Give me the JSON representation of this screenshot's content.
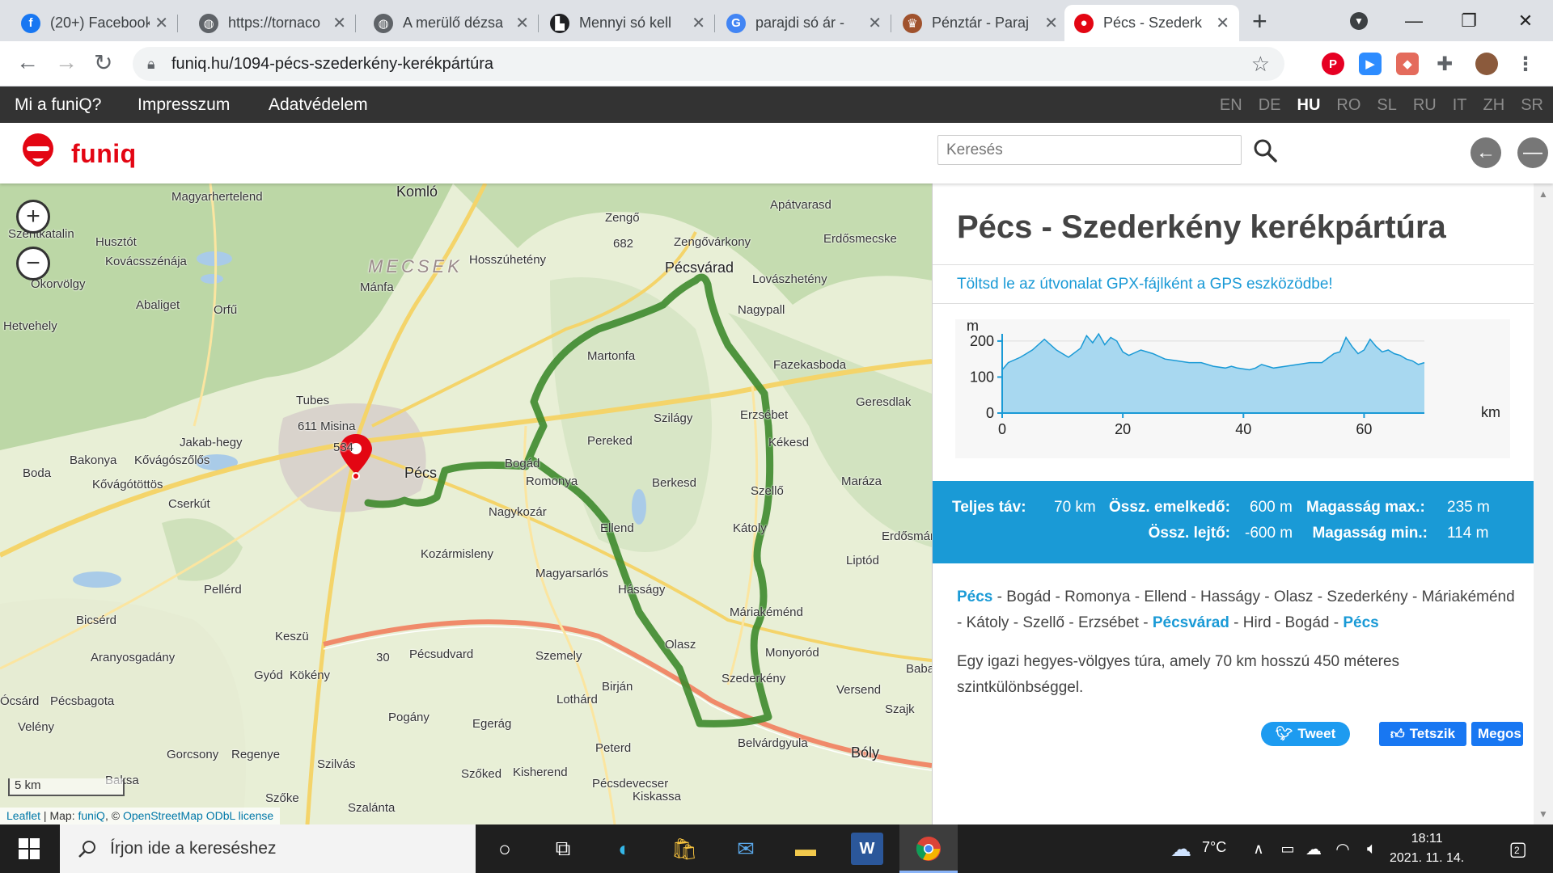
{
  "browser": {
    "tabs": [
      {
        "title": "(20+) Facebook",
        "favicon_color": "#1877f2",
        "favicon_glyph": "f"
      },
      {
        "title": "https://tornaco",
        "favicon_color": "#5f6368",
        "favicon_glyph": "◍"
      },
      {
        "title": "A merülő dézsa",
        "favicon_color": "#5f6368",
        "favicon_glyph": "◍"
      },
      {
        "title": "Mennyi só kell",
        "favicon_color": "#202124",
        "favicon_glyph": "▙"
      },
      {
        "title": "parajdi só ár -",
        "favicon_color": "#4285f4",
        "favicon_glyph": "G"
      },
      {
        "title": "Pénztár - Paraj",
        "favicon_color": "#a0522d",
        "favicon_glyph": "♛"
      },
      {
        "title": "Pécs - Szederk",
        "favicon_color": "#e30613",
        "favicon_glyph": "●",
        "active": true
      }
    ],
    "url": "funiq.hu/1094-pécs-szederkény-kerékpártúra"
  },
  "site": {
    "menu": [
      "Mi a funiQ?",
      "Impresszum",
      "Adatvédelem"
    ],
    "languages": [
      "EN",
      "DE",
      "HU",
      "RO",
      "SL",
      "RU",
      "IT",
      "ZH",
      "SR"
    ],
    "current_language": "HU",
    "brand": "funiq",
    "search_placeholder": "Keresés",
    "brand_color": "#e30613",
    "accent_color": "#1a9ad6"
  },
  "map": {
    "labels": [
      "Komló",
      "Magyarhertelend",
      "Szentkatalin",
      "Husztót",
      "Kovácsszénája",
      "Okorvölgy",
      "Abaliget",
      "Orfű",
      "Hetvehely",
      "Mánfa",
      "MECSEK",
      "Hosszúhetény",
      "Zengő",
      "682",
      "Apátvarasd",
      "Zengővárkony",
      "Erdősmecske",
      "Pécsvárad",
      "Lovászhetény",
      "Nagypall",
      "Martonfa",
      "Fazekasboda",
      "Geresdlak",
      "Tubes",
      "611 Misina",
      "Jakab-hegy",
      "534",
      "Szilágy",
      "Erzsébet",
      "Kékesd",
      "Pereked",
      "Bakonya",
      "Kővágószőlős",
      "Kővágótöttös",
      "Boda",
      "Pécs",
      "Bogád",
      "Romonya",
      "Berkesd",
      "Maráza",
      "Szellő",
      "Cserkút",
      "Nagykozár",
      "Ellend",
      "Kátoly",
      "Erdősmár",
      "Kozármisleny",
      "Magyarsarlós",
      "Liptód",
      "Pellérd",
      "Hásságy",
      "Bicsérd",
      "Keszü",
      "Máriakéménd",
      "Olasz",
      "Aranyosgadány",
      "Pécsudvard",
      "Szemely",
      "Monyoród",
      "30",
      "Gyód",
      "Kökény",
      "Szederkény",
      "Versend",
      "Pécsbagota",
      "Birján",
      "Lothárd",
      "Szajk",
      "Pogány",
      "Egerág",
      "Velény",
      "Belvárdgyula",
      "Gorcsony",
      "Regenye",
      "Peterd",
      "Bóly",
      "Szilvás",
      "Szőked",
      "Kisherend",
      "Pécsdevecser",
      "Kiskassa",
      "Baksa",
      "Szőke",
      "Szalánta",
      "Ócsárd",
      "Babarc"
    ],
    "zoom_in": "+",
    "zoom_out": "−",
    "scale": "5 km",
    "attribution": {
      "leaflet": "Leaflet",
      "map": "Map:",
      "funiq": "funiQ",
      "copy": ", ©",
      "osm": "OpenStreetMap",
      "odbl": "ODbL license"
    }
  },
  "tour": {
    "title": "Pécs - Szederkény kerékpártúra",
    "gpx_link": "Töltsd le az útvonalat GPX-fájlként a GPS eszközödbe!",
    "stats": {
      "total_label": "Teljes táv:",
      "total_value": "70 km",
      "ascent_label": "Össz. emelkedő:",
      "ascent_value": "600 m",
      "descent_label": "Össz. lejtő:",
      "descent_value": "-600 m",
      "max_label": "Magasság max.:",
      "max_value": "235 m",
      "min_label": "Magasság min.:",
      "min_value": "114 m"
    },
    "route": [
      {
        "name": "Pécs",
        "highlight": true
      },
      {
        "name": "Bogád"
      },
      {
        "name": "Romonya"
      },
      {
        "name": "Ellend"
      },
      {
        "name": "Hasságy"
      },
      {
        "name": "Olasz"
      },
      {
        "name": "Szederkény"
      },
      {
        "name": "Máriakéménd"
      },
      {
        "name": "Kátoly"
      },
      {
        "name": "Szellő"
      },
      {
        "name": "Erzsébet"
      },
      {
        "name": "Pécsvárad",
        "highlight": true
      },
      {
        "name": "Hird"
      },
      {
        "name": "Bogád"
      },
      {
        "name": "Pécs",
        "highlight": true
      }
    ],
    "description": "Egy igazi hegyes-völgyes túra, amely 70 km hosszú 450 méteres szintkülönbséggel.",
    "share": {
      "tweet": "Tweet",
      "like": "Tetszik",
      "share": "Megos"
    }
  },
  "chart_data": {
    "type": "area",
    "title": "",
    "xlabel": "km",
    "ylabel": "m",
    "xlim": [
      0,
      70
    ],
    "ylim": [
      0,
      220
    ],
    "xticks": [
      0,
      20,
      40,
      60
    ],
    "yticks": [
      0,
      100,
      200
    ],
    "grid": true,
    "series": [
      {
        "x": [
          0,
          1,
          3,
          5,
          7,
          9,
          11,
          13,
          14,
          15,
          16,
          17,
          18,
          19,
          20,
          21,
          23,
          25,
          27,
          29,
          31,
          33,
          35,
          37,
          38,
          39,
          41,
          42,
          43,
          45,
          47,
          49,
          51,
          53,
          55,
          56,
          57,
          58,
          59,
          60,
          61,
          62,
          63,
          64,
          65,
          66,
          67,
          68,
          69,
          70
        ],
        "y": [
          120,
          140,
          155,
          175,
          205,
          175,
          155,
          180,
          215,
          195,
          220,
          190,
          210,
          200,
          170,
          160,
          175,
          165,
          150,
          145,
          140,
          140,
          130,
          125,
          130,
          125,
          120,
          125,
          135,
          125,
          130,
          135,
          140,
          140,
          165,
          170,
          210,
          185,
          165,
          175,
          205,
          185,
          170,
          175,
          165,
          160,
          150,
          145,
          135,
          140
        ]
      }
    ],
    "fill_color": "#a8d8f0",
    "line_color": "#1a9ad6"
  },
  "system": {
    "search_placeholder": "Írjon ide a kereséshez",
    "temperature": "7°C",
    "time": "18:11",
    "date": "2021. 11. 14.",
    "notification_count": "2"
  }
}
